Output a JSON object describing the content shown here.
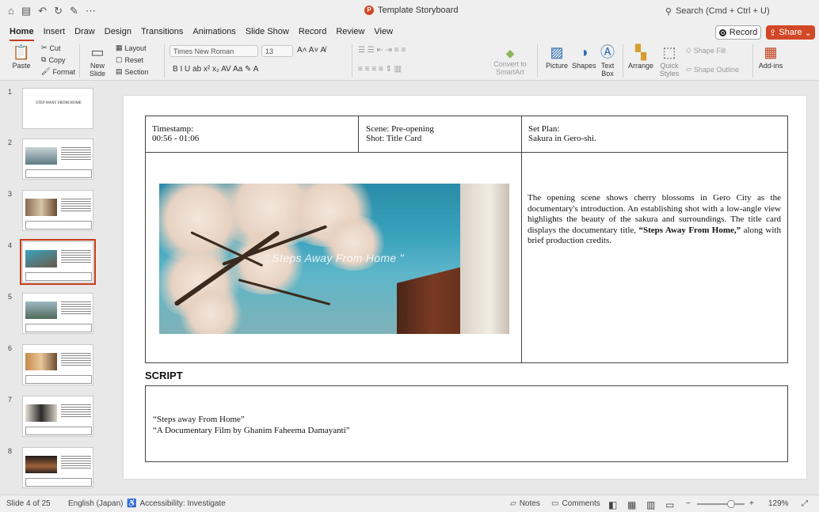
{
  "titlebar": {
    "title": "Template Storyboard",
    "search": "Search (Cmd + Ctrl + U)",
    "icons": [
      "home-icon",
      "save-icon",
      "undo-icon",
      "redo-icon",
      "draw-icon",
      "more-icon"
    ]
  },
  "tabs": [
    "Home",
    "Insert",
    "Draw",
    "Design",
    "Transitions",
    "Animations",
    "Slide Show",
    "Record",
    "Review",
    "View"
  ],
  "active_tab": "Home",
  "record_label": "Record",
  "share_label": "Share",
  "ribbon": {
    "paste": "Paste",
    "cut": "Cut",
    "copy": "Copy",
    "format": "Format",
    "new_slide": "New Slide",
    "layout": "Layout",
    "reset": "Reset",
    "section": "Section",
    "font": "Times New Roman",
    "font_size": "13",
    "convert_smartart": "Convert to SmartArt",
    "picture": "Picture",
    "shapes": "Shapes",
    "text_box": "Text Box",
    "arrange": "Arrange",
    "quick_styles": "Quick Styles",
    "shape_fill": "Shape Fill",
    "shape_outline": "Shape Outline",
    "addins": "Add-ins"
  },
  "thumbnails": {
    "numbers": [
      "1",
      "2",
      "3",
      "4",
      "5",
      "6",
      "7",
      "8"
    ],
    "selected": "4",
    "slide1_title": "STEP AWAY FROM HOME"
  },
  "slide": {
    "timestamp_label": "Timestamp:",
    "timestamp_value": "00:56 - 01:06",
    "scene": "Scene: Pre-opening",
    "shot": "Shot: Title Card",
    "set_plan_label": "Set Plan:",
    "set_plan_value": "Sakura in Gero-shi.",
    "overlay_title": "\" Steps Away From Home \"",
    "description_pre": "The opening scene shows cherry blossoms in Gero City as the documentary's introduction. An establishing shot with a low-angle view highlights the beauty of the sakura and surroundings. The title card displays the documentary title, ",
    "description_bold": "“Steps Away From Home,”",
    "description_post": " along with brief production credits.",
    "script_label": "SCRIPT",
    "script_line1": "“Steps away From Home”",
    "script_line2": "“A Documentary Film by Ghanim Faheema Damayanti”"
  },
  "status": {
    "slide_info": "Slide 4 of 25",
    "language": "English (Japan)",
    "accessibility": "Accessibility: Investigate",
    "notes": "Notes",
    "comments": "Comments",
    "zoom": "129%"
  },
  "colors": {
    "accent": "#c43e1c",
    "share": "#d24726"
  }
}
